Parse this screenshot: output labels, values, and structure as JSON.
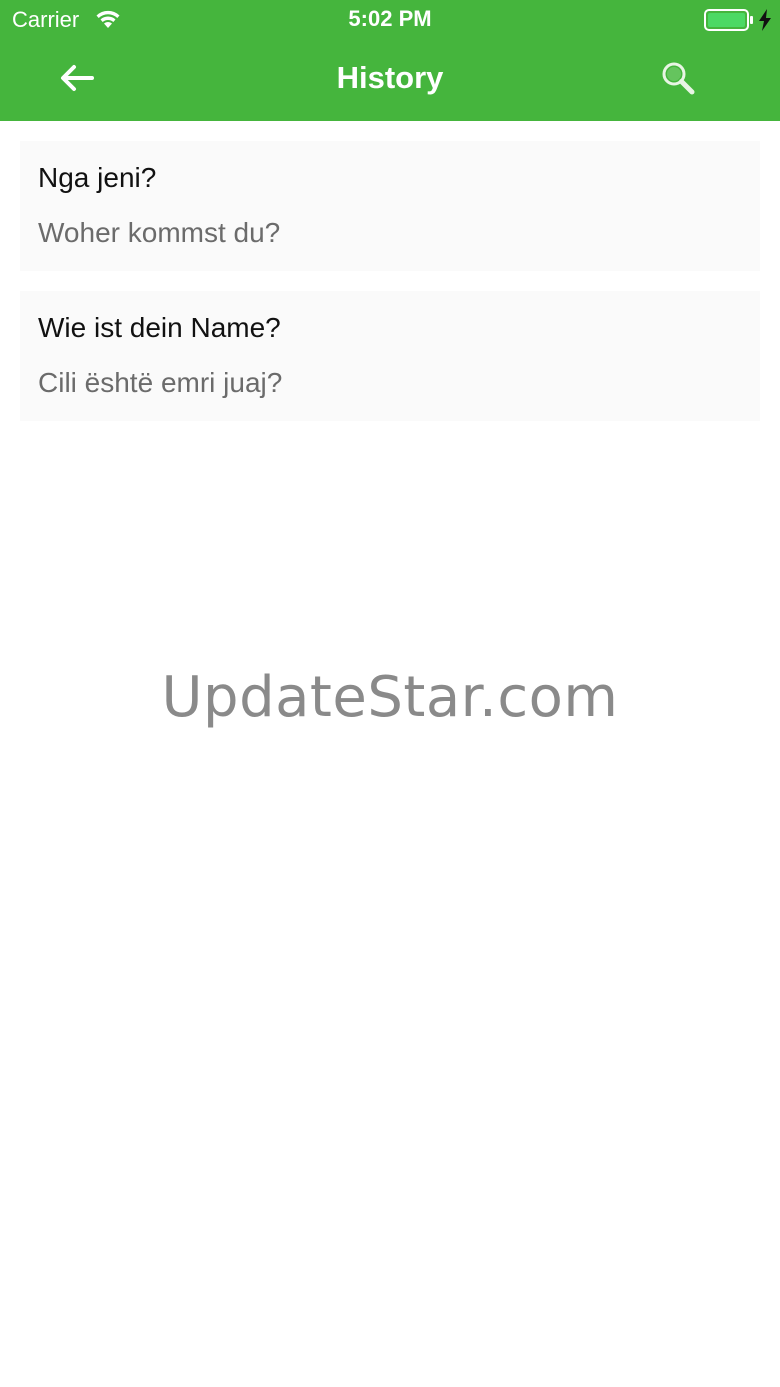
{
  "status_bar": {
    "carrier": "Carrier",
    "time": "5:02 PM",
    "battery_color": "#4cd964"
  },
  "nav": {
    "title": "History",
    "back_icon": "arrow-left-icon",
    "search_icon": "search-icon",
    "bar_color": "#45b53d"
  },
  "history": {
    "items": [
      {
        "source": "Nga jeni?",
        "translation": "Woher kommst du?"
      },
      {
        "source": "Wie ist dein Name?",
        "translation": "Cili është emri juaj?"
      }
    ]
  },
  "watermark": "UpdateStar.com"
}
